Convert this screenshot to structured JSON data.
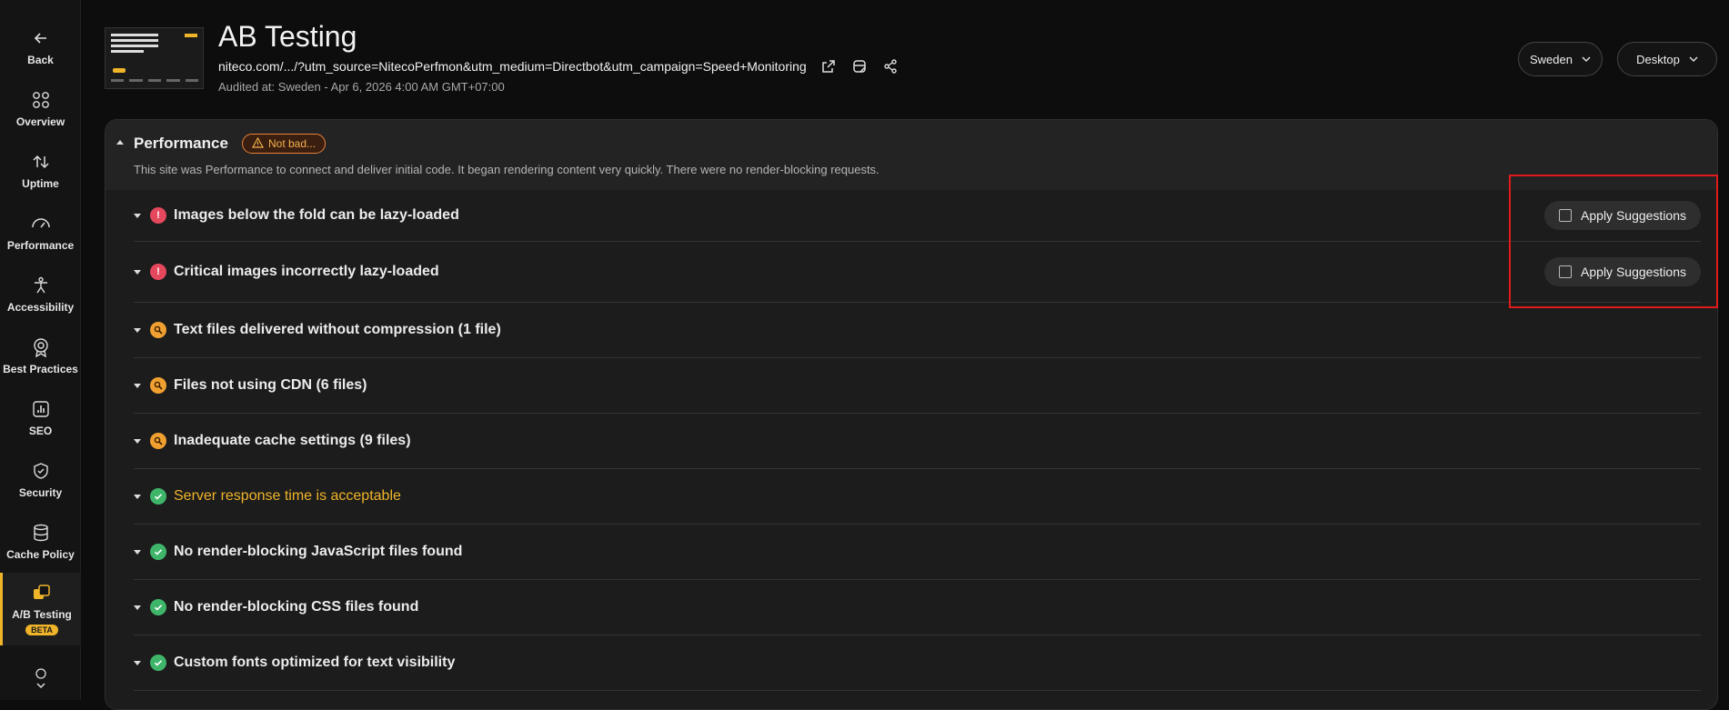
{
  "sidebar": {
    "items": [
      {
        "label": "Back",
        "icon": "arrow-left-icon"
      },
      {
        "label": "Overview",
        "icon": "grid-icon"
      },
      {
        "label": "Uptime",
        "icon": "up-down-arrows-icon"
      },
      {
        "label": "Performance",
        "icon": "speedometer-icon"
      },
      {
        "label": "Accessibility",
        "icon": "person-icon"
      },
      {
        "label": "Best Practices",
        "icon": "award-icon"
      },
      {
        "label": "SEO",
        "icon": "bar-chart-icon"
      },
      {
        "label": "Security",
        "icon": "shield-check-icon"
      },
      {
        "label": "Cache Policy",
        "icon": "database-icon"
      },
      {
        "label": "A/B Testing",
        "icon": "ab-testing-icon",
        "badge": "BETA",
        "active": true
      }
    ]
  },
  "header": {
    "title": "AB Testing",
    "url": "niteco.com/.../?utm_source=NitecoPerfmon&utm_medium=Directbot&utm_campaign=Speed+Monitoring",
    "audited": "Audited at: Sweden - Apr 6, 2026 4:00 AM GMT+07:00",
    "region": "Sweden",
    "device": "Desktop"
  },
  "panel": {
    "title": "Performance",
    "badge": "Not bad...",
    "description": "This site was Performance to connect and deliver initial code. It began rendering content very quickly. There were no render-blocking requests.",
    "apply_label": "Apply Suggestions",
    "items": [
      {
        "title": "Images below the fold can be lazy-loaded",
        "status": "error",
        "has_apply": true
      },
      {
        "title": "Critical images incorrectly lazy-loaded",
        "status": "error",
        "has_apply": true
      },
      {
        "title": "Text files delivered without compression (1 file)",
        "status": "warning"
      },
      {
        "title": "Files not using CDN (6 files)",
        "status": "warning"
      },
      {
        "title": "Inadequate cache settings (9 files)",
        "status": "warning"
      },
      {
        "title": "Server response time is acceptable",
        "status": "ok"
      },
      {
        "title": "No render-blocking JavaScript files found",
        "status": "ok"
      },
      {
        "title": "No render-blocking CSS files found",
        "status": "ok"
      },
      {
        "title": "Custom fonts optimized for text visibility",
        "status": "ok"
      }
    ]
  },
  "colors": {
    "accent": "#f0b429",
    "error": "#e5485d",
    "warning": "#f0a030",
    "ok": "#3fb56a",
    "highlight": "#e01b1b"
  }
}
